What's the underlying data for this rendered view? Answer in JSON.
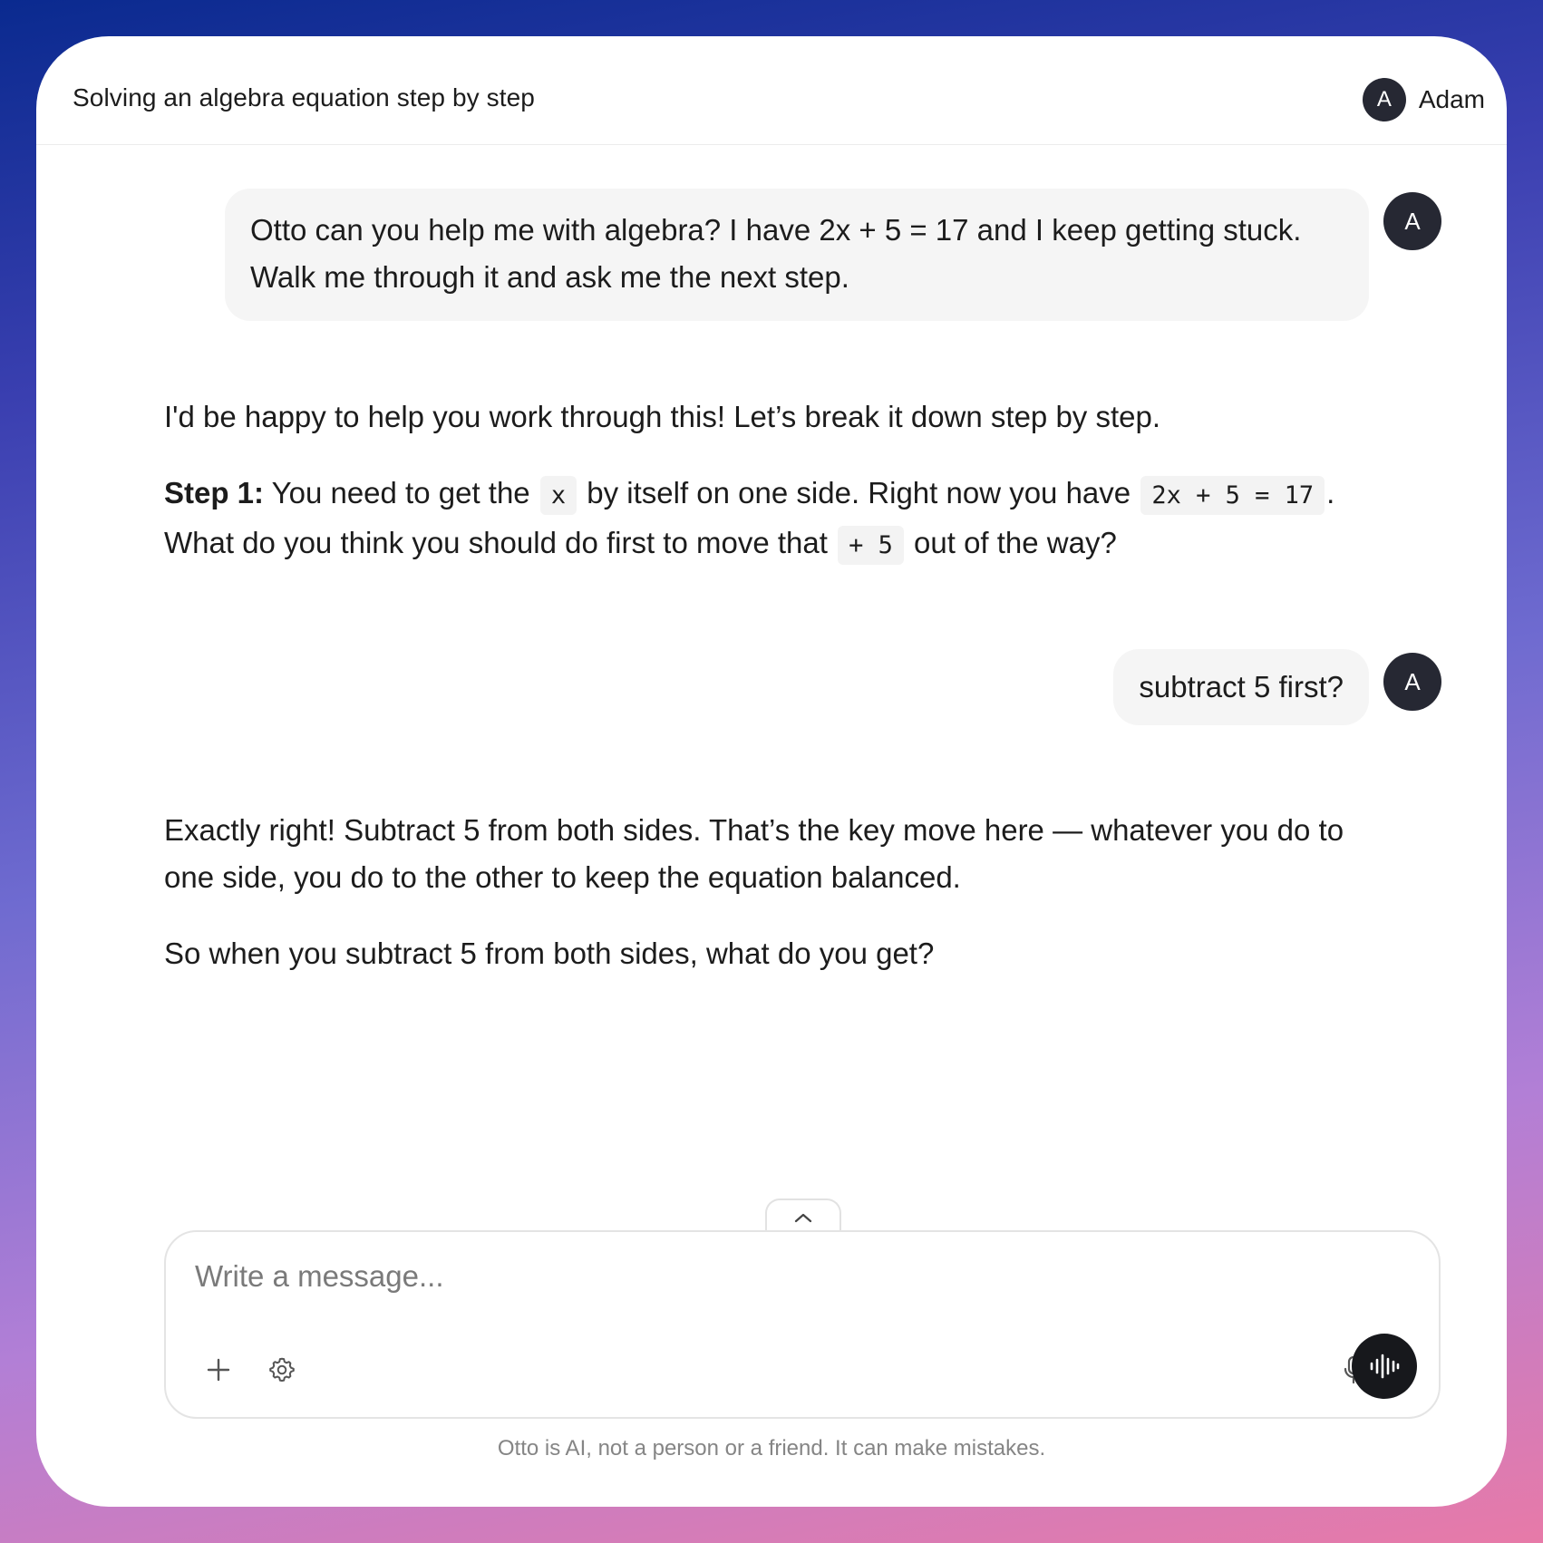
{
  "header": {
    "title": "Solving an algebra equation step by step",
    "user_initial": "A",
    "user_name": "Adam"
  },
  "messages": [
    {
      "role": "user",
      "avatar": "A",
      "lines": [
        "Otto can you help me with algebra? I have 2x + 5 = 17 and I keep getting stuck.",
        "Walk me through it and ask me the next step."
      ]
    },
    {
      "role": "assistant",
      "intro": "I'd be happy to help you work through this! Let’s break it down step by step.",
      "step_label": "Step 1:",
      "seg1": "You need to get the",
      "code1": "x",
      "seg2": "by itself on one side. Right now you have",
      "code2": "2x + 5 = 17",
      "seg3": ".",
      "seg4": "What do you think you should do first to move that",
      "code3": "+ 5",
      "seg5": "out of the way?"
    },
    {
      "role": "user",
      "avatar": "A",
      "text": "subtract 5 first?"
    },
    {
      "role": "assistant",
      "line1": "Exactly right! Subtract 5 from both sides. That’s the key move here — whatever you do to",
      "line2": "one side, you do to the other to keep the equation balanced.",
      "para2": "So when you subtract 5 from both sides, what do you get?"
    }
  ],
  "composer": {
    "placeholder": "Write a message...",
    "value": "",
    "icons": [
      "plus-icon",
      "settings-icon",
      "microphone-icon",
      "voice-waveform-icon",
      "chevron-up-icon"
    ]
  },
  "disclaimer": "Otto is AI, not a person or a friend. It can make mistakes."
}
